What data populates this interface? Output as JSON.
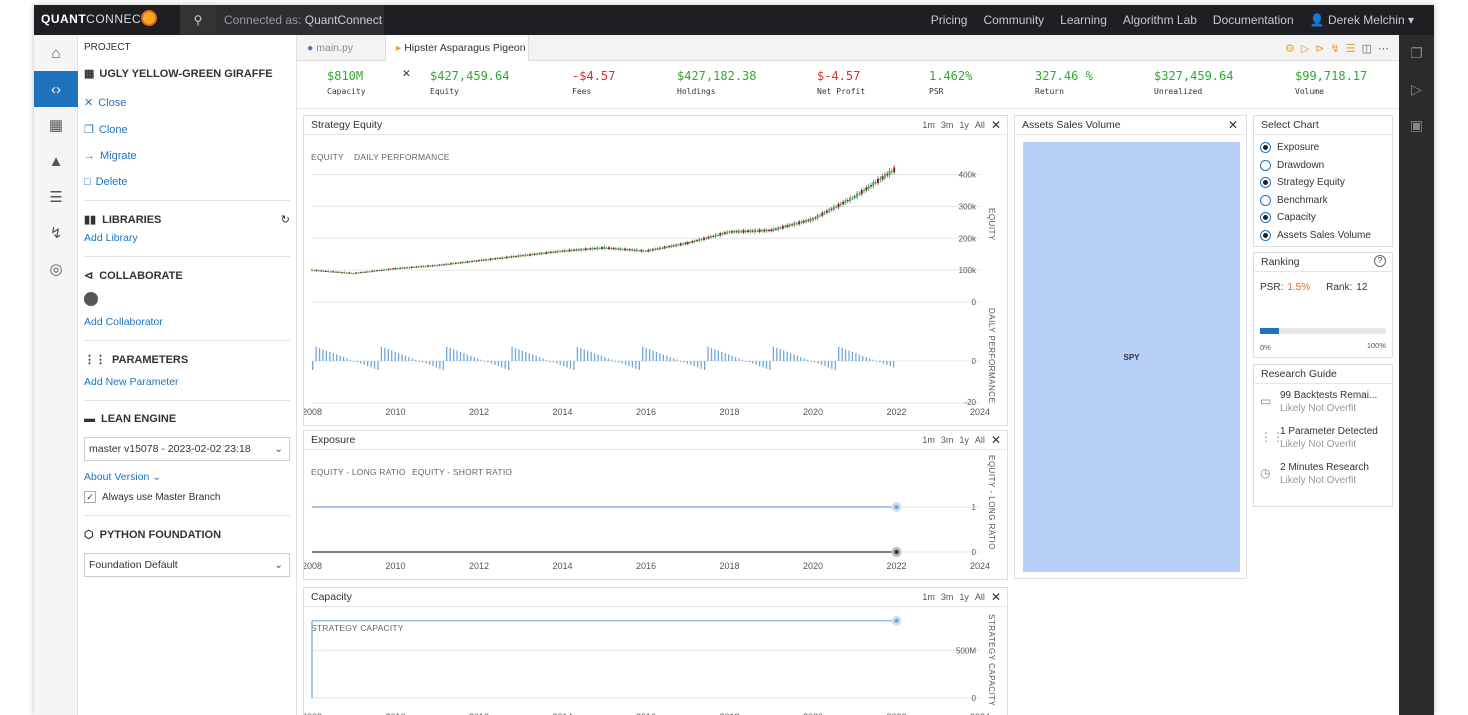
{
  "topbar": {
    "logo_a": "QUANT",
    "logo_b": "CONNECT",
    "connected_prefix": "Connected as:",
    "connected_user": "QuantConnect",
    "nav": [
      "Pricing",
      "Community",
      "Learning",
      "Algorithm Lab",
      "Documentation"
    ],
    "user": "Derek Melchin"
  },
  "project": {
    "header": "PROJECT",
    "name": "UGLY YELLOW-GREEN GIRAFFE",
    "actions": [
      "Close",
      "Clone",
      "Migrate",
      "Delete"
    ],
    "libraries_title": "LIBRARIES",
    "add_library": "Add Library",
    "collaborate_title": "COLLABORATE",
    "add_collaborator": "Add Collaborator",
    "parameters_title": "PARAMETERS",
    "add_parameter": "Add New Parameter",
    "lean_title": "LEAN ENGINE",
    "lean_version": "master v15078 - 2023-02-02 23:18",
    "about_version": "About Version",
    "always_master": "Always use Master Branch",
    "python_title": "PYTHON FOUNDATION",
    "foundation": "Foundation Default"
  },
  "tabs": {
    "file": "main.py",
    "backtest": "Hipster Asparagus Pigeon"
  },
  "stats": [
    {
      "value": "$810M",
      "label": "Capacity",
      "color": "#2eaa2e"
    },
    {
      "value": "$427,459.64",
      "label": "Equity",
      "color": "#2eaa2e"
    },
    {
      "value": "-$4.57",
      "label": "Fees",
      "color": "#d9312b"
    },
    {
      "value": "$427,182.38",
      "label": "Holdings",
      "color": "#2eaa2e"
    },
    {
      "value": "$-4.57",
      "label": "Net Profit",
      "color": "#d9312b"
    },
    {
      "value": "1.462%",
      "label": "PSR",
      "color": "#2eaa2e"
    },
    {
      "value": "327.46 %",
      "label": "Return",
      "color": "#2eaa2e"
    },
    {
      "value": "$327,459.64",
      "label": "Unrealized",
      "color": "#2eaa2e"
    },
    {
      "value": "$99,718.17",
      "label": "Volume",
      "color": "#2eaa2e"
    }
  ],
  "ranges": [
    "1m",
    "3m",
    "1y",
    "All"
  ],
  "x_ticks": [
    "2008",
    "2010",
    "2012",
    "2014",
    "2016",
    "2018",
    "2020",
    "2022",
    "2024"
  ],
  "strategy_equity": {
    "title": "Strategy Equity",
    "legend_equity": "EQUITY",
    "legend_daily": "DAILY PERFORMANCE",
    "equity_label": "EQUITY",
    "daily_label": "DAILY PERFORMANCE",
    "y_ticks": [
      "400k",
      "300k",
      "200k",
      "100k",
      "0"
    ],
    "daily_ticks": [
      "0",
      "-20"
    ]
  },
  "exposure": {
    "title": "Exposure",
    "legend_long": "EQUITY - LONG RATIO",
    "legend_short": "EQUITY - SHORT RATIO",
    "axis_label": "EQUITY - LONG RATIO",
    "y_ticks": [
      "1",
      "0"
    ]
  },
  "capacity": {
    "title": "Capacity",
    "legend": "STRATEGY CAPACITY",
    "axis_label": "STRATEGY CAPACITY",
    "y_ticks": [
      "500M",
      "0"
    ]
  },
  "assets_sales": {
    "title": "Assets Sales Volume",
    "symbol": "SPY"
  },
  "select_chart": {
    "title": "Select Chart",
    "options": [
      {
        "label": "Exposure",
        "checked": true
      },
      {
        "label": "Drawdown",
        "checked": false
      },
      {
        "label": "Strategy Equity",
        "checked": true
      },
      {
        "label": "Benchmark",
        "checked": false
      },
      {
        "label": "Capacity",
        "checked": true
      },
      {
        "label": "Assets Sales Volume",
        "checked": true
      }
    ]
  },
  "ranking": {
    "title": "Ranking",
    "psr_label": "PSR:",
    "psr_value": "1.5%",
    "rank_label": "Rank:",
    "rank_value": "12",
    "progress": 0.15,
    "min": "0%",
    "max": "100%"
  },
  "research": {
    "title": "Research Guide",
    "items": [
      {
        "title": "99 Backtests Remai...",
        "sub": "Likely Not Overfit"
      },
      {
        "title": "1 Parameter Detected",
        "sub": "Likely Not Overfit"
      },
      {
        "title": "2 Minutes Research",
        "sub": "Likely Not Overfit"
      }
    ]
  },
  "chart_data": [
    {
      "type": "line",
      "title": "Strategy Equity",
      "x": [
        2008,
        2009,
        2010,
        2011,
        2012,
        2013,
        2014,
        2015,
        2016,
        2017,
        2018,
        2019,
        2020,
        2021,
        2022
      ],
      "series": [
        {
          "name": "EQUITY",
          "values": [
            100000,
            90000,
            105000,
            115000,
            130000,
            145000,
            160000,
            170000,
            160000,
            185000,
            220000,
            225000,
            260000,
            330000,
            420000
          ]
        }
      ],
      "ylabel": "EQUITY",
      "ylim": [
        0,
        430000
      ]
    },
    {
      "type": "line",
      "title": "Exposure",
      "x": [
        2008,
        2022
      ],
      "series": [
        {
          "name": "EQUITY - LONG RATIO",
          "values": [
            1,
            1
          ]
        },
        {
          "name": "EQUITY - SHORT RATIO",
          "values": [
            0,
            0
          ]
        }
      ],
      "ylim": [
        0,
        1
      ]
    },
    {
      "type": "line",
      "title": "Capacity",
      "x": [
        2008,
        2022
      ],
      "series": [
        {
          "name": "STRATEGY CAPACITY",
          "values": [
            810000000,
            810000000
          ]
        }
      ],
      "ylim": [
        0,
        850000000
      ]
    }
  ]
}
